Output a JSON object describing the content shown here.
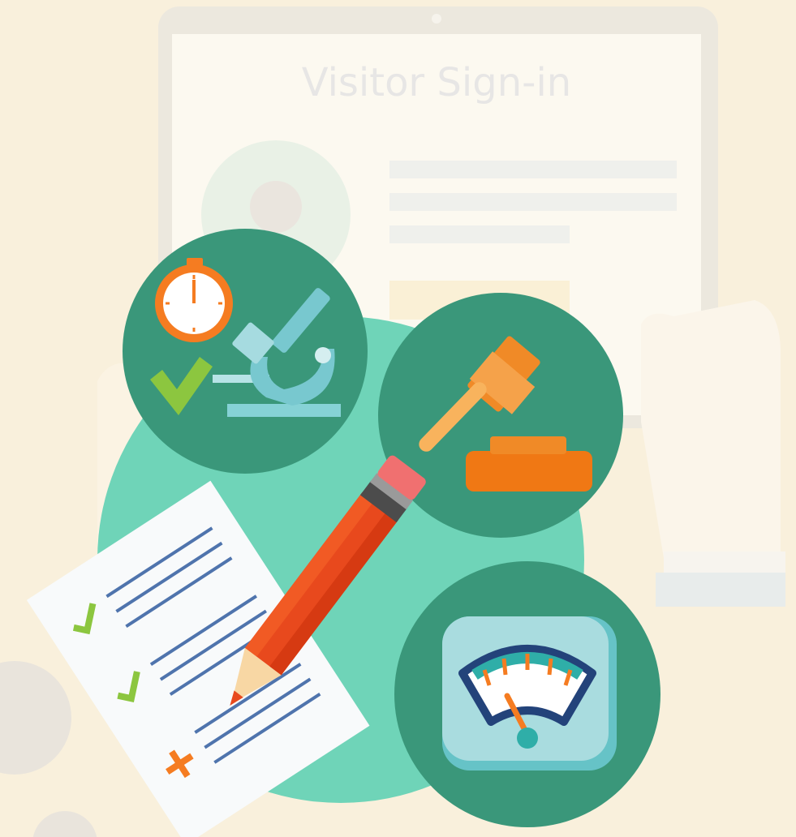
{
  "tablet": {
    "heading": "Visitor Sign-in"
  },
  "icons": {
    "stopwatch": "stopwatch-icon",
    "microscope": "microscope-icon",
    "checkmark": "checkmark-icon",
    "gavel": "gavel-icon",
    "pencil": "pencil-icon",
    "checklist": "checklist-icon",
    "gauge": "gauge-icon"
  },
  "colors": {
    "background": "#f9f0dc",
    "teal_dark": "#3a977a",
    "teal_light": "#6fd4b8",
    "orange": "#f57c21",
    "green_check": "#8cc63f",
    "blue_lines": "#4f74ad"
  }
}
